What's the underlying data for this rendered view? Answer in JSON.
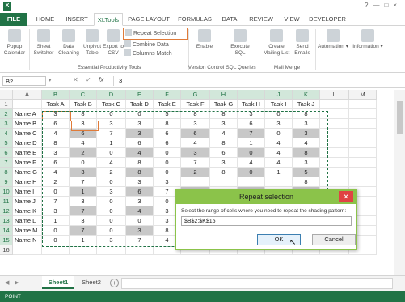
{
  "window": {
    "title": "",
    "sign_in": "",
    "controls": [
      "?",
      "—",
      "□",
      "×"
    ]
  },
  "tabs": [
    "FILE",
    "HOME",
    "INSERT",
    "XLTools",
    "PAGE LAYOUT",
    "FORMULAS",
    "DATA",
    "REVIEW",
    "VIEW",
    "DEVELOPER"
  ],
  "ribbon": {
    "popup_calendar": "Popup Calendar",
    "sheet_switcher": "Sheet Switcher",
    "data_cleaning": "Data Cleaning",
    "unpivot_table": "Unpivot Table",
    "export_to_csv": "Export to CSV",
    "repeat_selection": "Repeat Selection",
    "combine_data": "Combine Data",
    "columns_match": "Columns Match",
    "enable": "Enable",
    "execute_sql": "Execute SQL",
    "create_mailing_list": "Create Mailing List",
    "send_emails": "Send Emails",
    "automation": "Automation",
    "information": "Information",
    "groups": {
      "essential": "Essential Productivity Tools",
      "version_control": "Version Control",
      "sql_queries": "SQL Queries",
      "mail_merge": "Mail Merge"
    }
  },
  "formula_bar": {
    "name_box": "B2",
    "fx": "fx",
    "value": "3"
  },
  "columns": [
    "A",
    "B",
    "C",
    "D",
    "E",
    "F",
    "G",
    "H",
    "I",
    "J",
    "K",
    "L",
    "M"
  ],
  "rows": [
    "1",
    "2",
    "3",
    "4",
    "5",
    "6",
    "7",
    "8",
    "9",
    "10",
    "11",
    "12",
    "13",
    "14",
    "15",
    "16"
  ],
  "header_row": [
    "",
    "Task A",
    "Task B",
    "Task C",
    "Task D",
    "Task E",
    "Task F",
    "Task G",
    "Task H",
    "Task I",
    "Task J"
  ],
  "names": [
    "Name A",
    "Name B",
    "Name C",
    "Name D",
    "Name E",
    "Name F",
    "Name G",
    "Name H",
    "Name I",
    "Name J",
    "Name K",
    "Name L",
    "Name M",
    "Name N"
  ],
  "values": [
    [
      "3",
      "8",
      "0",
      "0",
      "5",
      "8",
      "8",
      "3",
      "0",
      "8"
    ],
    [
      "6",
      "3",
      "3",
      "3",
      "8",
      "3",
      "3",
      "6",
      "3",
      "3"
    ],
    [
      "4",
      "6",
      "7",
      "3",
      "6",
      "6",
      "4",
      "7",
      "0",
      "3"
    ],
    [
      "8",
      "4",
      "1",
      "6",
      "6",
      "4",
      "8",
      "1",
      "4",
      "4"
    ],
    [
      "3",
      "2",
      "0",
      "4",
      "0",
      "3",
      "6",
      "0",
      "4",
      "8"
    ],
    [
      "6",
      "0",
      "4",
      "8",
      "0",
      "7",
      "3",
      "4",
      "4",
      "3"
    ],
    [
      "4",
      "3",
      "2",
      "8",
      "0",
      "2",
      "8",
      "0",
      "1",
      "5"
    ],
    [
      "2",
      "7",
      "0",
      "3",
      "3",
      "",
      "",
      "",
      "",
      "8"
    ],
    [
      "0",
      "1",
      "3",
      "6",
      "7",
      "",
      "",
      "",
      "",
      ""
    ],
    [
      "7",
      "3",
      "0",
      "3",
      "0",
      "",
      "",
      "",
      "",
      ""
    ],
    [
      "3",
      "7",
      "0",
      "4",
      "3",
      "",
      "",
      "",
      "",
      ""
    ],
    [
      "1",
      "3",
      "0",
      "0",
      "3",
      "",
      "",
      "",
      "",
      ""
    ],
    [
      "0",
      "7",
      "0",
      "3",
      "8",
      "",
      "",
      "",
      "",
      ""
    ],
    [
      "0",
      "1",
      "3",
      "7",
      "4",
      "",
      "",
      "",
      "",
      ""
    ]
  ],
  "sheets": [
    "Sheet1",
    "Sheet2"
  ],
  "status": "POINT",
  "dialog": {
    "title": "Repeat selection",
    "prompt": "Select the range of cells where you need to repeat the shading pattern:",
    "range_value": "$B$2:$K$15",
    "ok": "OK",
    "cancel": "Cancel"
  },
  "colors": {
    "excel_green": "#217346",
    "dialog_green": "#8bc34a",
    "highlight_orange": "#e07b39",
    "shade_gray": "#c8c8c8"
  }
}
